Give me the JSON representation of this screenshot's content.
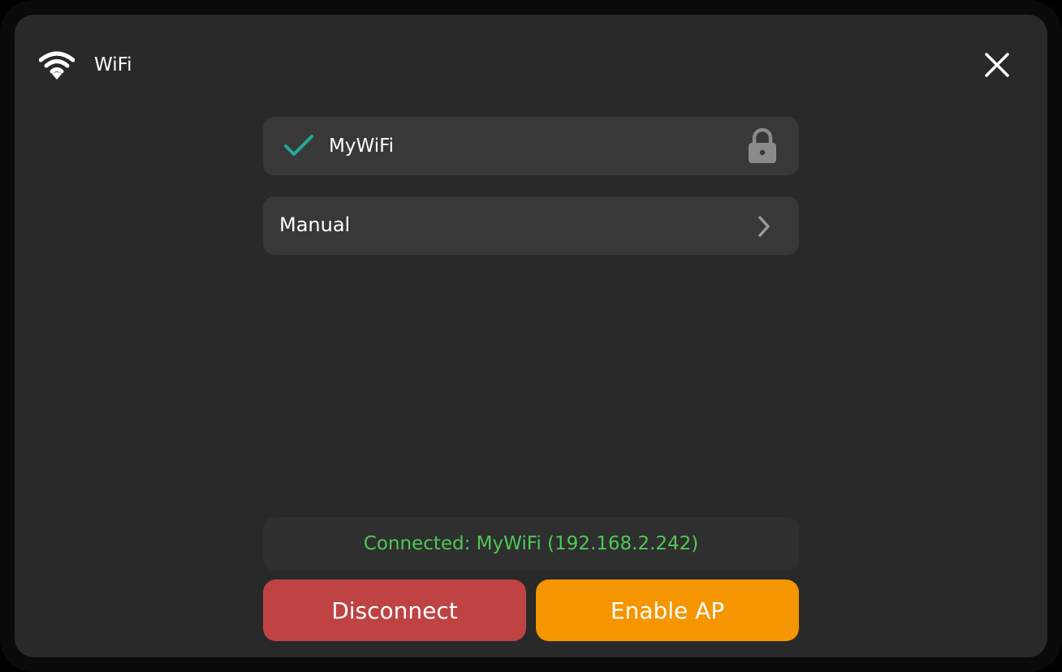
{
  "header": {
    "title": "WiFi",
    "icon": "wifi-icon",
    "close_icon": "close-icon"
  },
  "networks": [
    {
      "ssid": "MyWiFi",
      "connected": true,
      "secured": true,
      "status_icon": "check-icon",
      "security_icon": "lock-icon"
    }
  ],
  "manual": {
    "label": "Manual",
    "icon": "chevron-right-icon"
  },
  "status": {
    "text": "Connected: MyWiFi (192.168.2.242)"
  },
  "actions": {
    "disconnect_label": "Disconnect",
    "enable_ap_label": "Enable AP"
  },
  "colors": {
    "background": "#292929",
    "row": "#383838",
    "accent_check": "#25a89a",
    "status_text": "#4fc755",
    "disconnect": "#bf4343",
    "enable_ap": "#f59500",
    "icon_gray": "#8a8a8a"
  }
}
